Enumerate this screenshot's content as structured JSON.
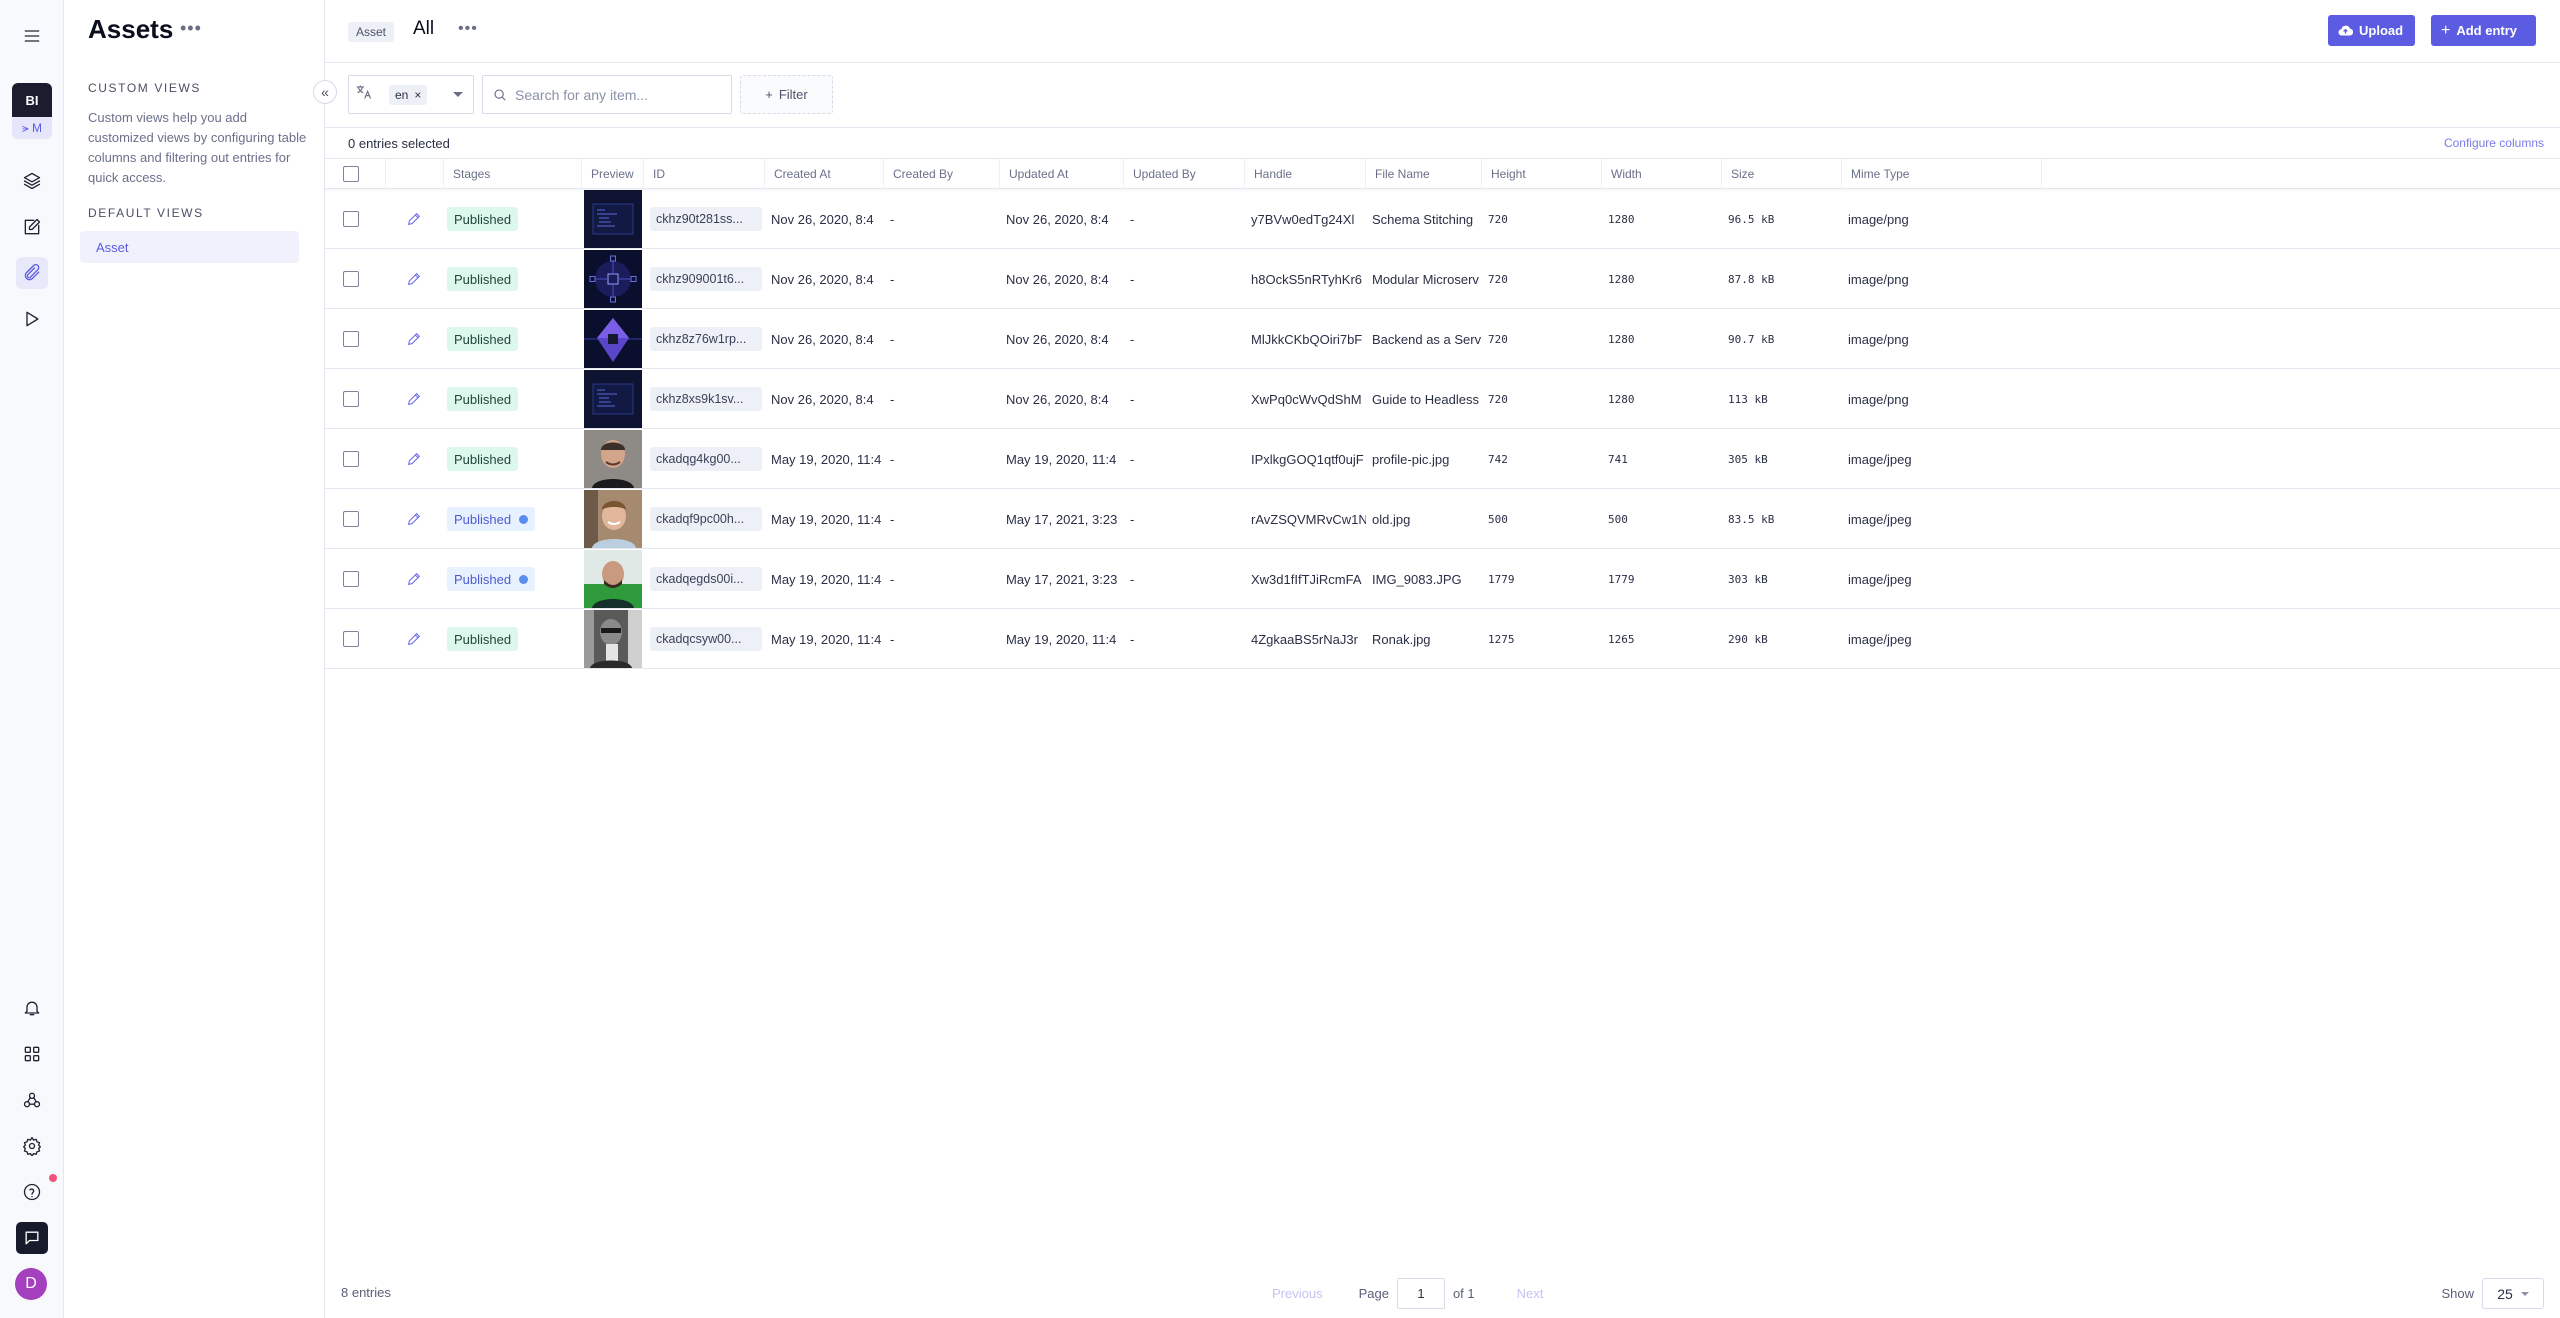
{
  "rail": {
    "project_initials": "BI",
    "project_sub": "⪫ M",
    "avatar_initial": "D",
    "icons": [
      "menu-icon",
      "layers-icon",
      "edit-icon",
      "attachment-icon",
      "play-icon",
      "bell-icon",
      "apps-icon",
      "webhook-icon",
      "settings-icon",
      "help-icon",
      "chat-icon"
    ]
  },
  "views": {
    "title": "Assets",
    "more": "•••",
    "custom_title": "CUSTOM VIEWS",
    "custom_desc": "Custom views help you add customized views by configuring table columns and filtering out entries for quick access.",
    "default_title": "DEFAULT VIEWS",
    "items": [
      {
        "label": "Asset"
      }
    ],
    "collapse": "«"
  },
  "header": {
    "badge": "Asset",
    "title": "All",
    "more": "•••",
    "upload_label": "Upload",
    "add_label": "Add entry"
  },
  "toolbar": {
    "locale": "en",
    "locale_remove": "×",
    "search_placeholder": "Search for any item...",
    "filter_label": "Filter"
  },
  "selection": {
    "text": "0 entries selected",
    "configure": "Configure columns"
  },
  "accent": "#5b5ce2",
  "table": {
    "columns": [
      "",
      "",
      "Stages",
      "Preview",
      "ID",
      "Created At",
      "Created By",
      "Updated At",
      "Updated By",
      "Handle",
      "File Name",
      "Height",
      "Width",
      "Size",
      "Mime Type"
    ],
    "rows": [
      {
        "stage": "Published",
        "changed": false,
        "preview": "dark-code",
        "id": "ckhz90t281ss...",
        "created_at": "Nov 26, 2020, 8:4",
        "created_by": "-",
        "updated_at": "Nov 26, 2020, 8:4",
        "updated_by": "-",
        "handle": "y7BVw0edTg24Xl",
        "file_name": "Schema Stitching",
        "height": "720",
        "width": "1280",
        "size": "96.5 kB",
        "mime": "image/png"
      },
      {
        "stage": "Published",
        "changed": false,
        "preview": "dark-network",
        "id": "ckhz909001t6...",
        "created_at": "Nov 26, 2020, 8:4",
        "created_by": "-",
        "updated_at": "Nov 26, 2020, 8:4",
        "updated_by": "-",
        "handle": "h8OckS5nRTyhKr6",
        "file_name": "Modular Microserv",
        "height": "720",
        "width": "1280",
        "size": "87.8 kB",
        "mime": "image/png"
      },
      {
        "stage": "Published",
        "changed": false,
        "preview": "dark-crystal",
        "id": "ckhz8z76w1rp...",
        "created_at": "Nov 26, 2020, 8:4",
        "created_by": "-",
        "updated_at": "Nov 26, 2020, 8:4",
        "updated_by": "-",
        "handle": "MlJkkCKbQOiri7bF",
        "file_name": "Backend as a Serv",
        "height": "720",
        "width": "1280",
        "size": "90.7 kB",
        "mime": "image/png"
      },
      {
        "stage": "Published",
        "changed": false,
        "preview": "dark-code",
        "id": "ckhz8xs9k1sv...",
        "created_at": "Nov 26, 2020, 8:4",
        "created_by": "-",
        "updated_at": "Nov 26, 2020, 8:4",
        "updated_by": "-",
        "handle": "XwPq0cWvQdShM",
        "file_name": "Guide to Headless",
        "height": "720",
        "width": "1280",
        "size": "113 kB",
        "mime": "image/png"
      },
      {
        "stage": "Published",
        "changed": false,
        "preview": "portrait-1",
        "id": "ckadqg4kg00...",
        "created_at": "May 19, 2020, 11:4",
        "created_by": "-",
        "updated_at": "May 19, 2020, 11:4",
        "updated_by": "-",
        "handle": "IPxlkgGOQ1qtf0ujF",
        "file_name": "profile-pic.jpg",
        "height": "742",
        "width": "741",
        "size": "305 kB",
        "mime": "image/jpeg"
      },
      {
        "stage": "Published",
        "changed": true,
        "preview": "portrait-2",
        "id": "ckadqf9pc00h...",
        "created_at": "May 19, 2020, 11:4",
        "created_by": "-",
        "updated_at": "May 17, 2021, 3:23",
        "updated_by": "-",
        "handle": "rAvZSQVMRvCw1N",
        "file_name": "old.jpg",
        "height": "500",
        "width": "500",
        "size": "83.5 kB",
        "mime": "image/jpeg"
      },
      {
        "stage": "Published",
        "changed": true,
        "preview": "portrait-3",
        "id": "ckadqegds00i...",
        "created_at": "May 19, 2020, 11:4",
        "created_by": "-",
        "updated_at": "May 17, 2021, 3:23",
        "updated_by": "-",
        "handle": "Xw3d1fIfTJiRcmFA",
        "file_name": "IMG_9083.JPG",
        "height": "1779",
        "width": "1779",
        "size": "303 kB",
        "mime": "image/jpeg"
      },
      {
        "stage": "Published",
        "changed": false,
        "preview": "portrait-4",
        "id": "ckadqcsyw00...",
        "created_at": "May 19, 2020, 11:4",
        "created_by": "-",
        "updated_at": "May 19, 2020, 11:4",
        "updated_by": "-",
        "handle": "4ZgkaaBS5rNaJ3r",
        "file_name": "Ronak.jpg",
        "height": "1275",
        "width": "1265",
        "size": "290 kB",
        "mime": "image/jpeg"
      }
    ]
  },
  "footer": {
    "count": "8 entries",
    "previous": "Previous",
    "page_label": "Page",
    "page_value": "1",
    "of_label": "of 1",
    "next": "Next",
    "show_label": "Show",
    "page_size": "25"
  }
}
